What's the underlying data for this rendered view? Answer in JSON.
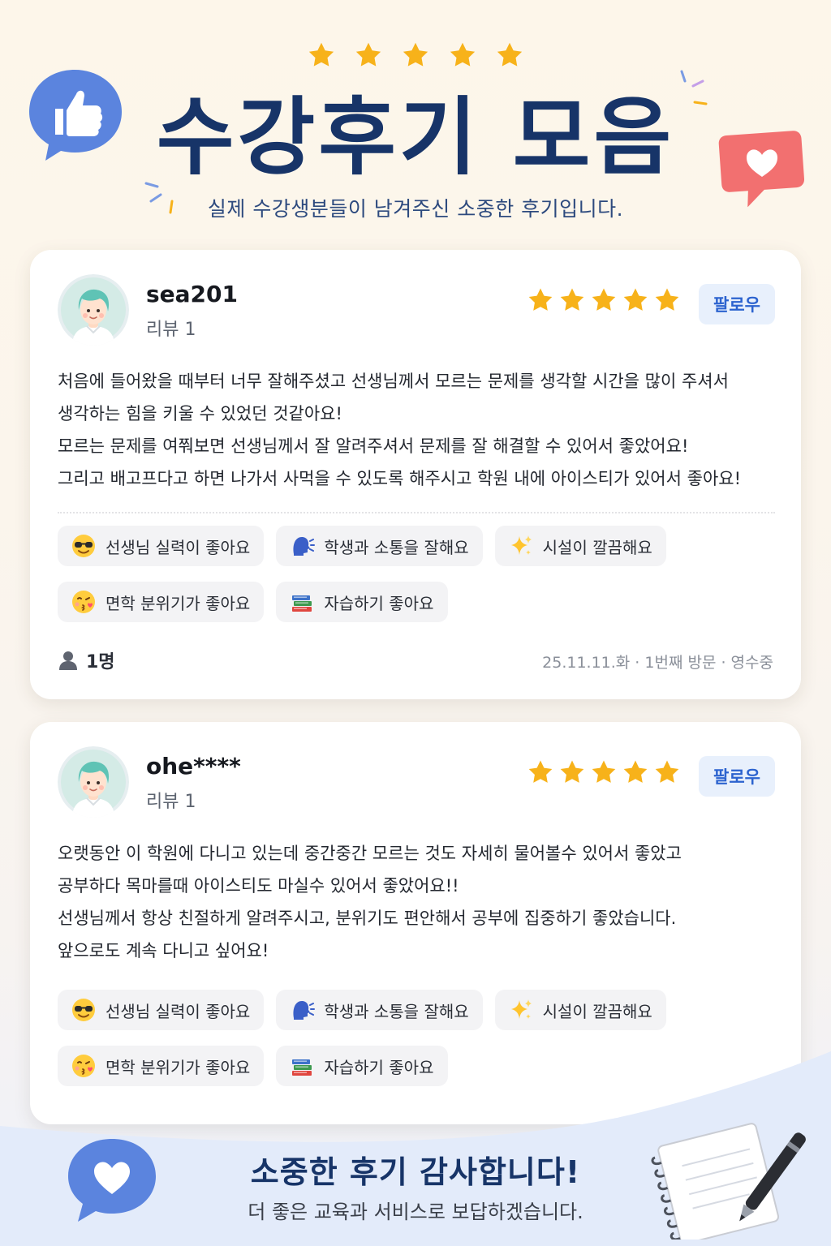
{
  "header": {
    "title": "수강후기 모음",
    "subtitle": "실제 수강생분들이 남겨주신 소중한 후기입니다."
  },
  "colors": {
    "title": "#173468",
    "star": "#f7b21a",
    "follow_text": "#2c63cf",
    "follow_bg": "#e8f0fc",
    "thumbs_bubble": "#5b84de",
    "heart_bubble": "#f27070",
    "banner_bg": "#e3ebfa"
  },
  "reviews": [
    {
      "username": "sea201",
      "review_count": "리뷰 1",
      "rating": 5,
      "follow_label": "팔로우",
      "text_lines": [
        "처음에 들어왔을 때부터 너무 잘해주셨고 선생님께서 모르는 문제를 생각할 시간을 많이 주셔서",
        "생각하는 힘을 키울 수 있었던 것같아요!",
        "모르는 문제를 여쭤보면 선생님께서 잘 알려주셔서 문제를 잘 해결할 수 있어서 좋았어요!",
        "그리고 배고프다고 하면 나가서 사먹을 수 있도록 해주시고 학원 내에 아이스티가 있어서 좋아요!"
      ],
      "tags": [
        {
          "icon": "sunglasses-emoji-icon",
          "label": "선생님 실력이 좋아요"
        },
        {
          "icon": "speaking-head-icon",
          "label": "학생과 소통을 잘해요"
        },
        {
          "icon": "sparkles-icon",
          "label": "시설이 깔끔해요"
        },
        {
          "icon": "kissing-face-icon",
          "label": "면학 분위기가 좋아요"
        },
        {
          "icon": "books-icon",
          "label": "자습하기 좋아요"
        }
      ],
      "visitor_count": "1명",
      "visit_meta": "25.11.11.화 · 1번째 방문 · 영수중"
    },
    {
      "username": "ohe****",
      "review_count": "리뷰 1",
      "rating": 5,
      "follow_label": "팔로우",
      "text_lines": [
        "오랫동안 이 학원에 다니고 있는데 중간중간 모르는 것도 자세히 물어볼수 있어서 좋았고",
        "공부하다 목마를때 아이스티도 마실수 있어서 좋았어요!!",
        "선생님께서 항상 친절하게 알려주시고, 분위기도 편안해서 공부에 집중하기 좋았습니다.",
        "앞으로도 계속 다니고 싶어요!"
      ],
      "tags": [
        {
          "icon": "sunglasses-emoji-icon",
          "label": "선생님 실력이 좋아요"
        },
        {
          "icon": "speaking-head-icon",
          "label": "학생과 소통을 잘해요"
        },
        {
          "icon": "sparkles-icon",
          "label": "시설이 깔끔해요"
        },
        {
          "icon": "kissing-face-icon",
          "label": "면학 분위기가 좋아요"
        },
        {
          "icon": "books-icon",
          "label": "자습하기 좋아요"
        }
      ]
    }
  ],
  "footer": {
    "title": "소중한 후기 감사합니다!",
    "subtitle": "더 좋은 교육과 서비스로 보답하겠습니다."
  }
}
